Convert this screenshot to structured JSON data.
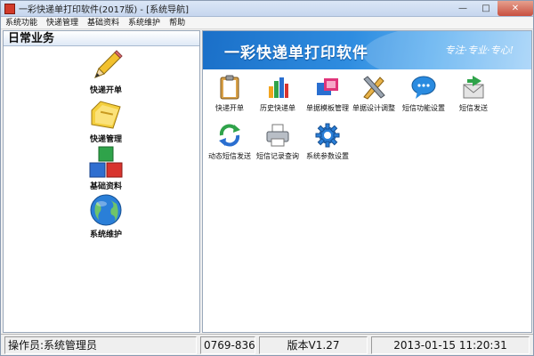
{
  "window": {
    "title": "一彩快递单打印软件(2017版) - [系统导航]",
    "controls": {
      "minimize": "—",
      "maximize": "□",
      "close": "✕"
    }
  },
  "menu": [
    "系统功能",
    "快递管理",
    "基础资料",
    "系统维护",
    "帮助"
  ],
  "sidebar": {
    "header": "日常业务",
    "items": [
      {
        "label": "快递开单",
        "icon": "pencil-icon"
      },
      {
        "label": "快递管理",
        "icon": "folder-icon"
      },
      {
        "label": "基础资料",
        "icon": "blocks-icon"
      },
      {
        "label": "系统维护",
        "icon": "globe-icon"
      }
    ]
  },
  "banner": {
    "title": "一彩快递单打印软件",
    "slogan": "专注·专业·专心!"
  },
  "functions": [
    {
      "label": "快递开单",
      "icon": "clipboard-icon"
    },
    {
      "label": "历史快递单",
      "icon": "bar-chart-icon"
    },
    {
      "label": "单据模板管理",
      "icon": "template-icon"
    },
    {
      "label": "单据设计调整",
      "icon": "design-tools-icon"
    },
    {
      "label": "短信功能设置",
      "icon": "chat-bubble-icon"
    },
    {
      "label": "短信发送",
      "icon": "send-mail-icon"
    },
    {
      "label": "动态短信发送",
      "icon": "refresh-icon"
    },
    {
      "label": "短信记录查询",
      "icon": "printer-icon"
    },
    {
      "label": "系统参数设置",
      "icon": "gear-icon"
    }
  ],
  "status": {
    "operator": "操作员:系统管理员",
    "phone": "0769-836",
    "version": "版本V1.27",
    "datetime": "2013-01-15 11:20:31"
  },
  "colors": {
    "banner_start": "#1a6fc8",
    "banner_end": "#9fd0f8",
    "accent_blue": "#2f8de0"
  }
}
